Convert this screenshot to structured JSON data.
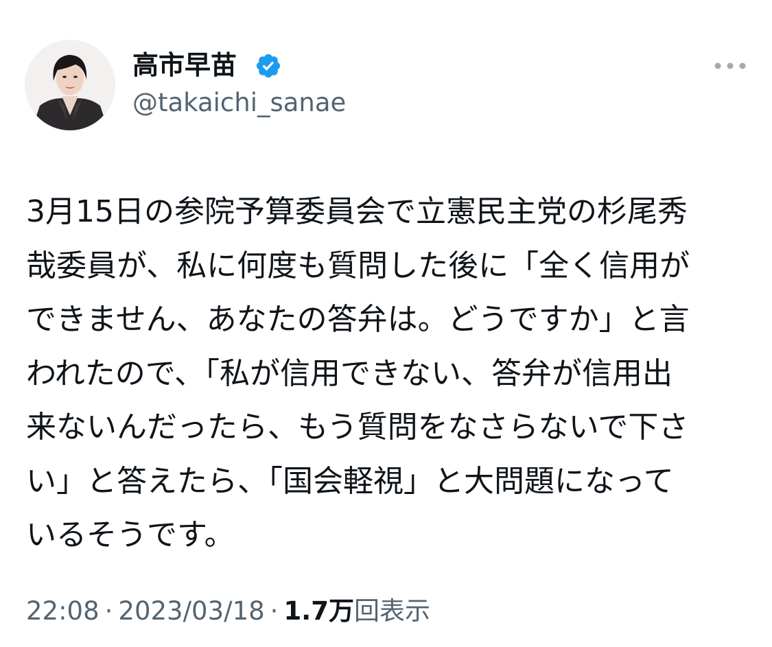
{
  "author": {
    "display_name": "高市早苗",
    "handle": "@takaichi_sanae",
    "verified": true,
    "verified_color": "#1d9bf0",
    "avatar_icon": "profile-photo"
  },
  "tweet": {
    "lines": [
      "3月15日の参院予算委員会で立憲民主党の杉尾秀",
      "哉委員が、私に何度も質問した後に「全く信用が",
      "できません、あなたの答弁は。どうですか」と言",
      "われたので、「私が信用できない、答弁が信用出",
      "来ないんだったら、もう質問をなさらないで下さ",
      "い」と答えたら、「国会軽視」と大問題になって",
      "いるそうです。"
    ]
  },
  "meta": {
    "time": "22:08",
    "separator": "·",
    "date": "2023/03/18",
    "views_count": "1.7万",
    "views_label": "回表示"
  },
  "colors": {
    "text_primary": "#0f1419",
    "text_secondary": "#536471",
    "background": "#ffffff"
  },
  "icons": {
    "verified": "verified-badge-icon",
    "more": "more-options-icon"
  }
}
